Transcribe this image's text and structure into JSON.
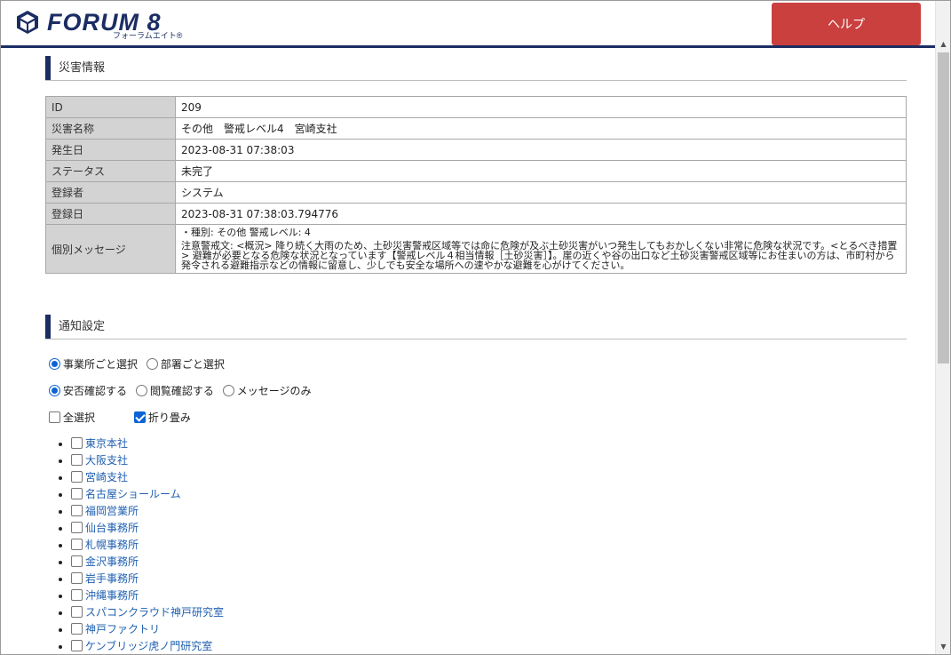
{
  "header": {
    "logo_word": "FORUM 8",
    "logo_kana": "フォーラムエイト®",
    "help_label": "ヘルプ",
    "help_color": "#c9403f",
    "accent": "#1b2d63"
  },
  "disaster": {
    "title": "災害情報",
    "rows": [
      {
        "label": "ID",
        "value": "209"
      },
      {
        "label": "災害名称",
        "value": "その他　警戒レベル4　宮崎支社"
      },
      {
        "label": "発生日",
        "value": "2023-08-31 07:38:03"
      },
      {
        "label": "ステータス",
        "value": "未完了"
      },
      {
        "label": "登録者",
        "value": "システム"
      },
      {
        "label": "登録日",
        "value": "2023-08-31 07:38:03.794776"
      }
    ],
    "message_label": "個別メッセージ",
    "message_line1": "・種別: その他 警戒レベル: 4",
    "message_line2": "注意警戒文: <概況> 降り続く大雨のため、土砂災害警戒区域等では命に危険が及ぶ土砂災害がいつ発生してもおかしくない非常に危険な状況です。<とるべき措置> 避難が必要となる危険な状況となっています【警戒レベル４相当情報［土砂災害］】。崖の近くや谷の出口など土砂災害警戒区域等にお住まいの方は、市町村から発令される避難指示などの情報に留意し、少しでも安全な場所への速やかな避難を心がけてください。"
  },
  "notify": {
    "title": "通知設定",
    "select_mode": [
      {
        "label": "事業所ごと選択",
        "checked": true
      },
      {
        "label": "部署ごと選択",
        "checked": false
      }
    ],
    "confirm_mode": [
      {
        "label": "安否確認する",
        "checked": true
      },
      {
        "label": "閲覧確認する",
        "checked": false
      },
      {
        "label": "メッセージのみ",
        "checked": false
      }
    ],
    "select_all_label": "全選択",
    "fold_label": "折り畳み",
    "offices": [
      "東京本社",
      "大阪支社",
      "宮崎支社",
      "名古屋ショールーム",
      "福岡営業所",
      "仙台事務所",
      "札幌事務所",
      "金沢事務所",
      "岩手事務所",
      "沖縄事務所",
      "スパコンクラウド神戸研究室",
      "神戸ファクトリ",
      "ケンブリッジ虎ノ門研究室"
    ]
  }
}
